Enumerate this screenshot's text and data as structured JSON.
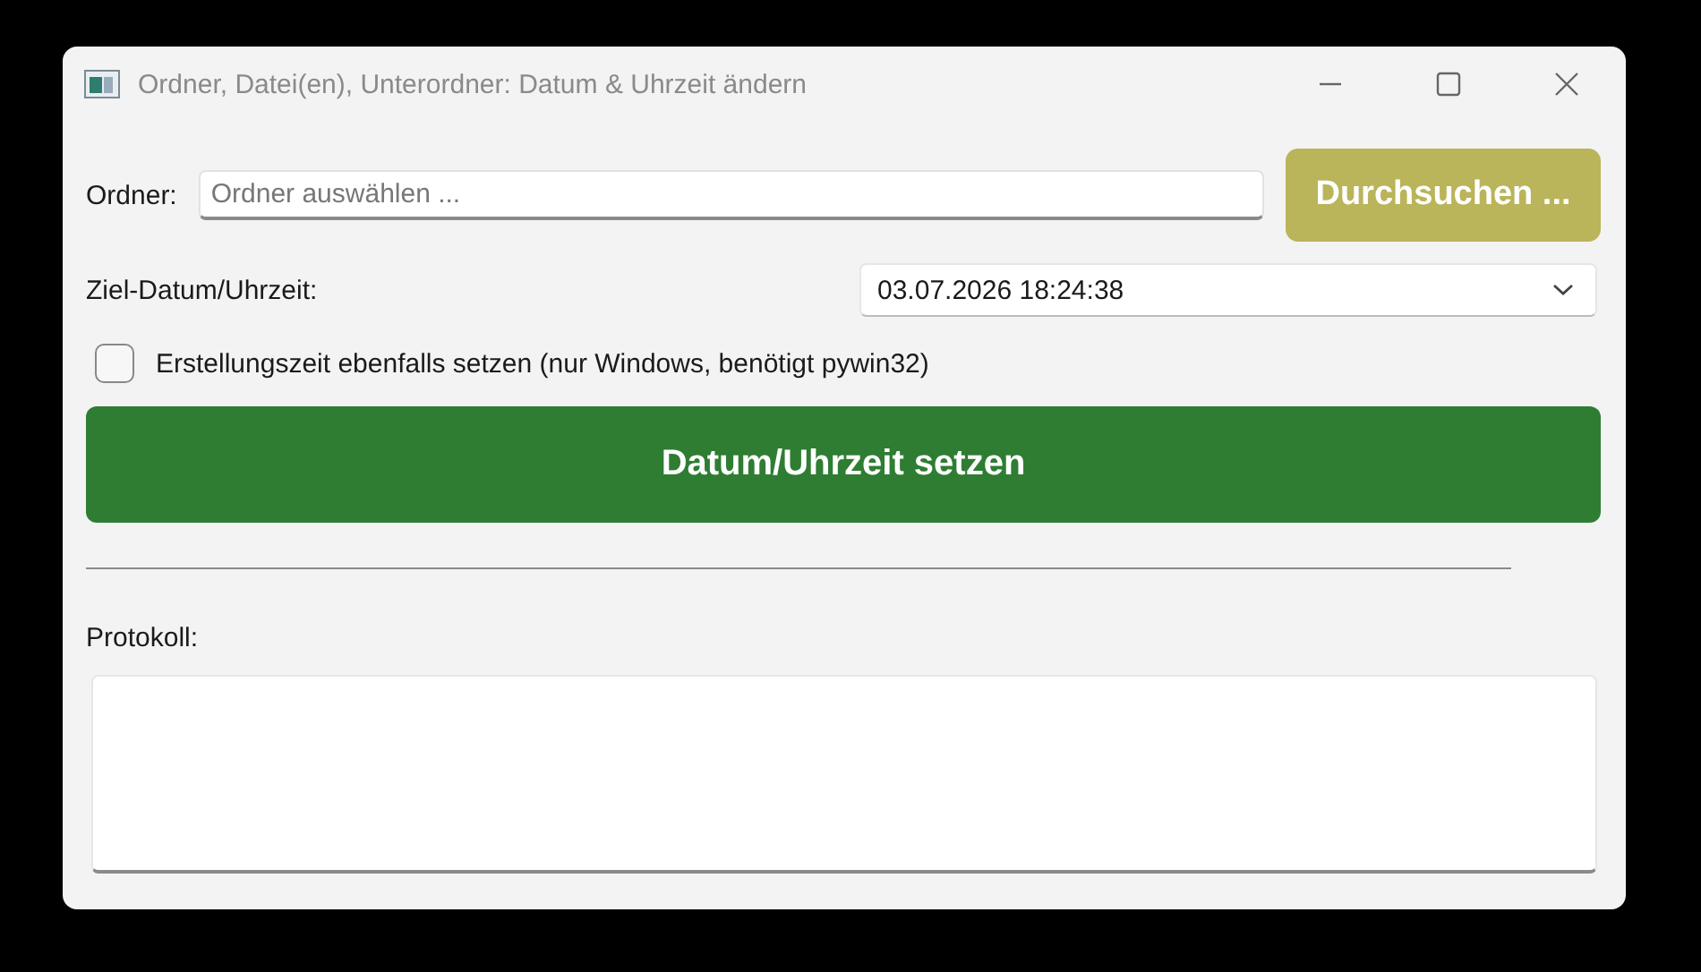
{
  "window": {
    "title": "Ordner, Datei(en), Unterordner: Datum & Uhrzeit ändern"
  },
  "folder": {
    "label": "Ordner:",
    "placeholder": "Ordner auswählen ...",
    "browse_button": "Durchsuchen ..."
  },
  "target": {
    "label": "Ziel-Datum/Uhrzeit:",
    "value": "03.07.2026 18:24:38"
  },
  "creation_time": {
    "label": "Erstellungszeit ebenfalls setzen (nur Windows, benötigt pywin32)",
    "checked": false
  },
  "apply_button": "Datum/Uhrzeit setzen",
  "log": {
    "label": "Protokoll:"
  }
}
